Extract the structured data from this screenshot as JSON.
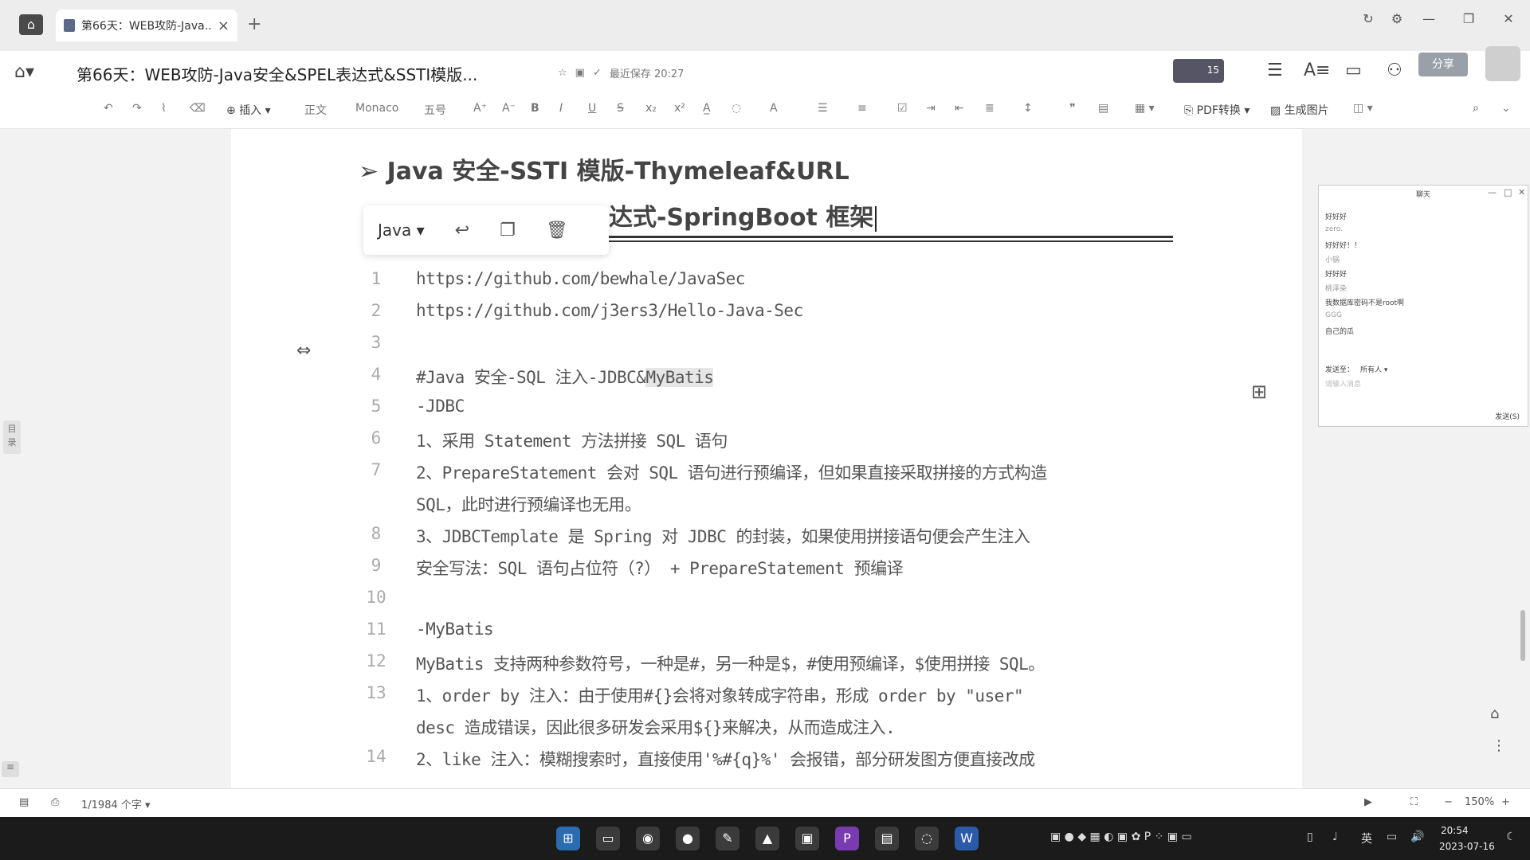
{
  "tab": {
    "label": "第66天：WEB攻防-Java...",
    "close": "×",
    "new": "+"
  },
  "header": {
    "title": "第66天：WEB攻防-Java安全&SPEL表达式&SSTI模版...",
    "save_status": "最近保存 20:27",
    "avatar_count": "15",
    "share": "分享"
  },
  "toolbar": {
    "insert": "插入",
    "style": "正文",
    "font": "Monaco",
    "size": "五号",
    "pdf": "PDF转换",
    "image": "生成图片"
  },
  "doc": {
    "heading1": "➢ Java 安全-SSTI 模版-Thymeleaf&URL",
    "heading2": "达式-SpringBoot 框架"
  },
  "code_toolbar": {
    "language": "Java"
  },
  "code_lines": [
    {
      "n": "1",
      "text": "https://github.com/bewhale/JavaSec"
    },
    {
      "n": "2",
      "text": "https://github.com/j3ers3/Hello-Java-Sec"
    },
    {
      "n": "3",
      "text": ""
    },
    {
      "n": "4",
      "text": "#Java 安全-SQL 注入-JDBC&",
      "hl": "MyBatis"
    },
    {
      "n": "5",
      "text": "-JDBC"
    },
    {
      "n": "6",
      "text": "1、采用 Statement 方法拼接 SQL 语句"
    },
    {
      "n": "7",
      "text": "2、PrepareStatement 会对 SQL 语句进行预编译，但如果直接采取拼接的方式构造"
    },
    {
      "n": "",
      "text": "SQL，此时进行预编译也无用。"
    },
    {
      "n": "8",
      "text": "3、JDBCTemplate 是 Spring 对 JDBC 的封装，如果使用拼接语句便会产生注入"
    },
    {
      "n": "9",
      "text": "安全写法：SQL 语句占位符（?） + PrepareStatement 预编译"
    },
    {
      "n": "10",
      "text": ""
    },
    {
      "n": "11",
      "text": "-MyBatis"
    },
    {
      "n": "12",
      "text": "MyBatis 支持两种参数符号，一种是#，另一种是$，#使用预编译，$使用拼接 SQL。"
    },
    {
      "n": "13",
      "text": "1、order by 注入：由于使用#{}会将对象转成字符串，形成 order by \"user\""
    },
    {
      "n": "",
      "text": "desc 造成错误，因此很多研发会采用${}来解决，从而造成注入."
    },
    {
      "n": "14",
      "text": "2、like 注入：模糊搜索时，直接使用'%#{q}%' 会报错，部分研发图方便直接改成"
    }
  ],
  "chat": {
    "title": "聊天",
    "messages": [
      {
        "text": "好好好",
        "kind": "msg"
      },
      {
        "text": "zero.",
        "kind": "name"
      },
      {
        "text": "好好好！！",
        "kind": "msg"
      },
      {
        "text": "小锅",
        "kind": "name"
      },
      {
        "text": "好好好",
        "kind": "msg"
      },
      {
        "text": "桃泽染",
        "kind": "name"
      },
      {
        "text": "我数据库密码不是root啊",
        "kind": "msg"
      },
      {
        "text": "GGG",
        "kind": "name"
      },
      {
        "text": "自己的瓜",
        "kind": "msg"
      }
    ],
    "send_to_label": "发送至：",
    "send_to_value": "所有人 ▾",
    "input_placeholder": "请输入消息",
    "send_button": "发送(S)"
  },
  "statusbar": {
    "word_count": "1/1984 个字 ▾",
    "zoom": "150%",
    "minus": "−",
    "plus": "+"
  },
  "taskbar": {
    "lang": "英",
    "time": "20:54",
    "date": "2023-07-16"
  }
}
